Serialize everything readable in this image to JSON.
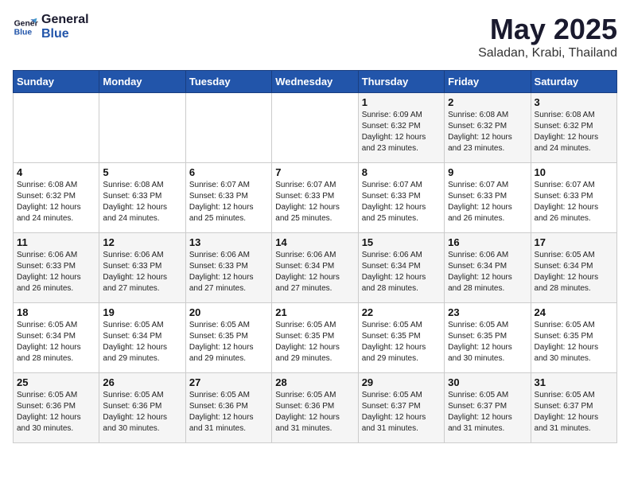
{
  "logo": {
    "line1": "General",
    "line2": "Blue"
  },
  "title": "May 2025",
  "subtitle": "Saladan, Krabi, Thailand",
  "days_header": [
    "Sunday",
    "Monday",
    "Tuesday",
    "Wednesday",
    "Thursday",
    "Friday",
    "Saturday"
  ],
  "weeks": [
    [
      {
        "day": "",
        "info": ""
      },
      {
        "day": "",
        "info": ""
      },
      {
        "day": "",
        "info": ""
      },
      {
        "day": "",
        "info": ""
      },
      {
        "day": "1",
        "info": "Sunrise: 6:09 AM\nSunset: 6:32 PM\nDaylight: 12 hours\nand 23 minutes."
      },
      {
        "day": "2",
        "info": "Sunrise: 6:08 AM\nSunset: 6:32 PM\nDaylight: 12 hours\nand 23 minutes."
      },
      {
        "day": "3",
        "info": "Sunrise: 6:08 AM\nSunset: 6:32 PM\nDaylight: 12 hours\nand 24 minutes."
      }
    ],
    [
      {
        "day": "4",
        "info": "Sunrise: 6:08 AM\nSunset: 6:32 PM\nDaylight: 12 hours\nand 24 minutes."
      },
      {
        "day": "5",
        "info": "Sunrise: 6:08 AM\nSunset: 6:33 PM\nDaylight: 12 hours\nand 24 minutes."
      },
      {
        "day": "6",
        "info": "Sunrise: 6:07 AM\nSunset: 6:33 PM\nDaylight: 12 hours\nand 25 minutes."
      },
      {
        "day": "7",
        "info": "Sunrise: 6:07 AM\nSunset: 6:33 PM\nDaylight: 12 hours\nand 25 minutes."
      },
      {
        "day": "8",
        "info": "Sunrise: 6:07 AM\nSunset: 6:33 PM\nDaylight: 12 hours\nand 25 minutes."
      },
      {
        "day": "9",
        "info": "Sunrise: 6:07 AM\nSunset: 6:33 PM\nDaylight: 12 hours\nand 26 minutes."
      },
      {
        "day": "10",
        "info": "Sunrise: 6:07 AM\nSunset: 6:33 PM\nDaylight: 12 hours\nand 26 minutes."
      }
    ],
    [
      {
        "day": "11",
        "info": "Sunrise: 6:06 AM\nSunset: 6:33 PM\nDaylight: 12 hours\nand 26 minutes."
      },
      {
        "day": "12",
        "info": "Sunrise: 6:06 AM\nSunset: 6:33 PM\nDaylight: 12 hours\nand 27 minutes."
      },
      {
        "day": "13",
        "info": "Sunrise: 6:06 AM\nSunset: 6:33 PM\nDaylight: 12 hours\nand 27 minutes."
      },
      {
        "day": "14",
        "info": "Sunrise: 6:06 AM\nSunset: 6:34 PM\nDaylight: 12 hours\nand 27 minutes."
      },
      {
        "day": "15",
        "info": "Sunrise: 6:06 AM\nSunset: 6:34 PM\nDaylight: 12 hours\nand 28 minutes."
      },
      {
        "day": "16",
        "info": "Sunrise: 6:06 AM\nSunset: 6:34 PM\nDaylight: 12 hours\nand 28 minutes."
      },
      {
        "day": "17",
        "info": "Sunrise: 6:05 AM\nSunset: 6:34 PM\nDaylight: 12 hours\nand 28 minutes."
      }
    ],
    [
      {
        "day": "18",
        "info": "Sunrise: 6:05 AM\nSunset: 6:34 PM\nDaylight: 12 hours\nand 28 minutes."
      },
      {
        "day": "19",
        "info": "Sunrise: 6:05 AM\nSunset: 6:34 PM\nDaylight: 12 hours\nand 29 minutes."
      },
      {
        "day": "20",
        "info": "Sunrise: 6:05 AM\nSunset: 6:35 PM\nDaylight: 12 hours\nand 29 minutes."
      },
      {
        "day": "21",
        "info": "Sunrise: 6:05 AM\nSunset: 6:35 PM\nDaylight: 12 hours\nand 29 minutes."
      },
      {
        "day": "22",
        "info": "Sunrise: 6:05 AM\nSunset: 6:35 PM\nDaylight: 12 hours\nand 29 minutes."
      },
      {
        "day": "23",
        "info": "Sunrise: 6:05 AM\nSunset: 6:35 PM\nDaylight: 12 hours\nand 30 minutes."
      },
      {
        "day": "24",
        "info": "Sunrise: 6:05 AM\nSunset: 6:35 PM\nDaylight: 12 hours\nand 30 minutes."
      }
    ],
    [
      {
        "day": "25",
        "info": "Sunrise: 6:05 AM\nSunset: 6:36 PM\nDaylight: 12 hours\nand 30 minutes."
      },
      {
        "day": "26",
        "info": "Sunrise: 6:05 AM\nSunset: 6:36 PM\nDaylight: 12 hours\nand 30 minutes."
      },
      {
        "day": "27",
        "info": "Sunrise: 6:05 AM\nSunset: 6:36 PM\nDaylight: 12 hours\nand 31 minutes."
      },
      {
        "day": "28",
        "info": "Sunrise: 6:05 AM\nSunset: 6:36 PM\nDaylight: 12 hours\nand 31 minutes."
      },
      {
        "day": "29",
        "info": "Sunrise: 6:05 AM\nSunset: 6:37 PM\nDaylight: 12 hours\nand 31 minutes."
      },
      {
        "day": "30",
        "info": "Sunrise: 6:05 AM\nSunset: 6:37 PM\nDaylight: 12 hours\nand 31 minutes."
      },
      {
        "day": "31",
        "info": "Sunrise: 6:05 AM\nSunset: 6:37 PM\nDaylight: 12 hours\nand 31 minutes."
      }
    ]
  ]
}
